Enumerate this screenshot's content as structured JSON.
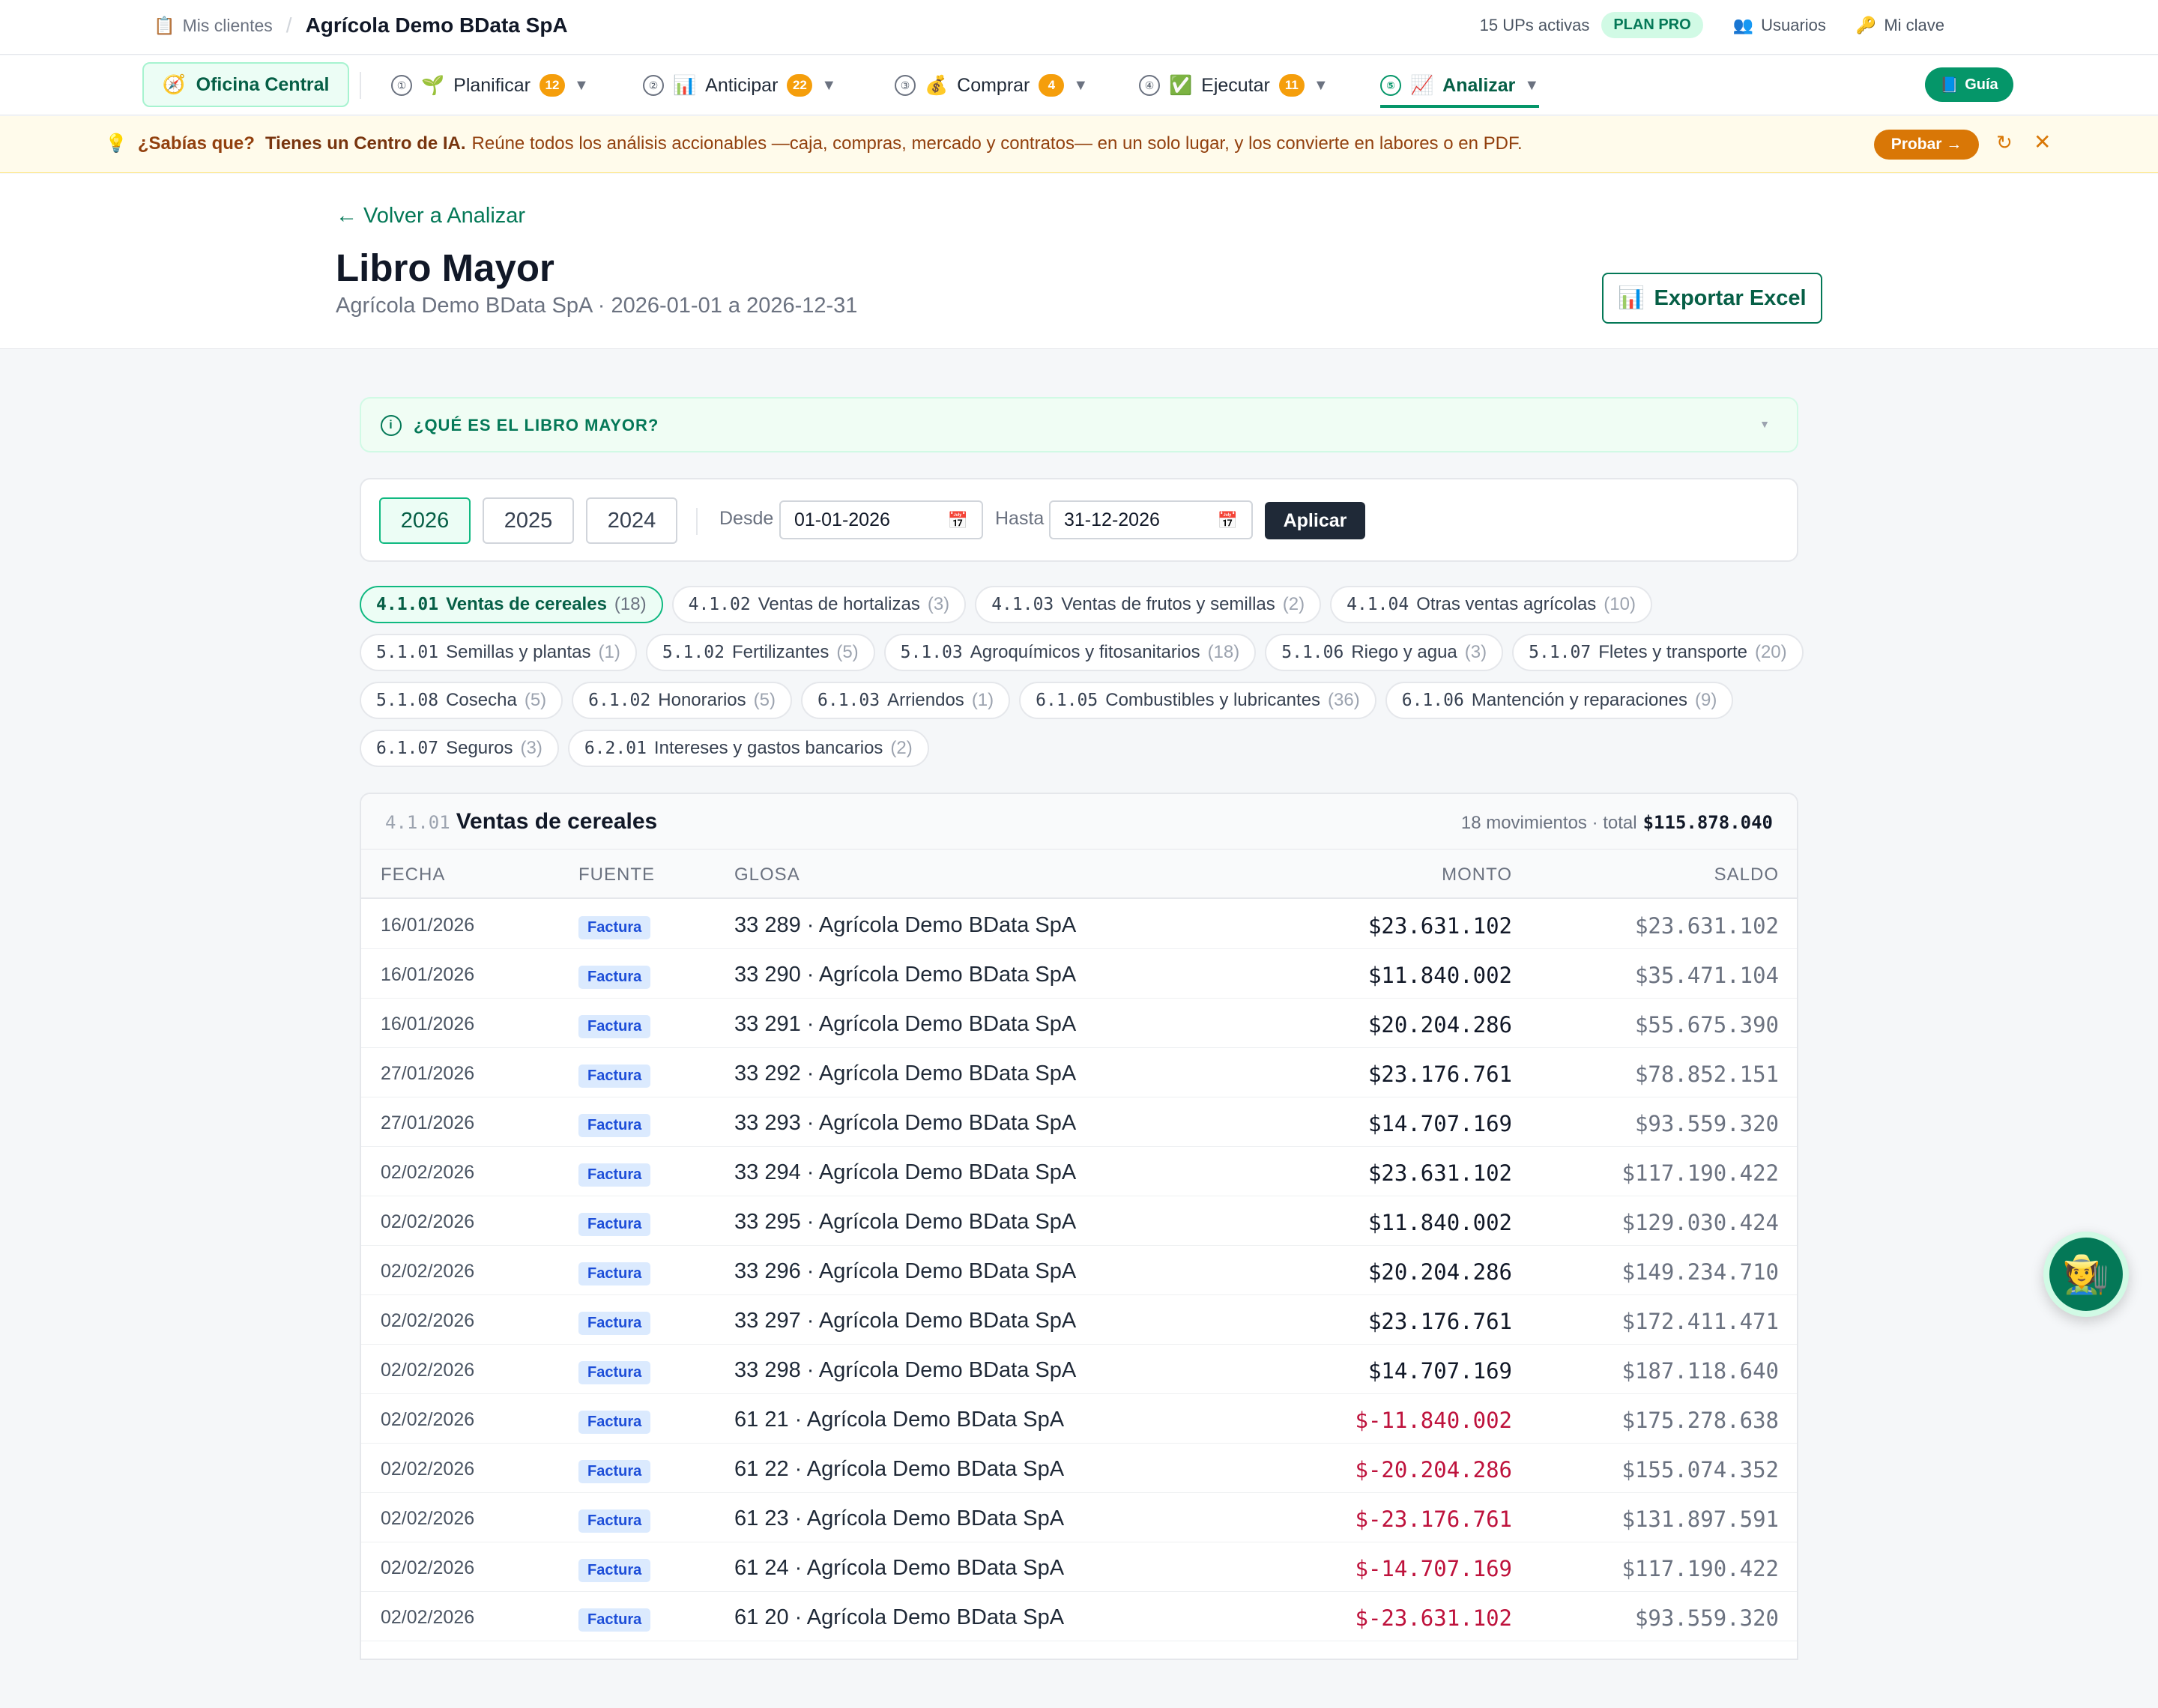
{
  "topbar": {
    "clients_label": "Mis clientes",
    "clients_icon": "clipboard-icon",
    "company": "Agrícola Demo BData SpA",
    "ups": "15 UPs activas",
    "plan": "PLAN PRO",
    "users": "Usuarios",
    "password": "Mi clave"
  },
  "nav": {
    "office": "Oficina Central",
    "items": [
      {
        "num": "①",
        "label": "Planificar",
        "badge": "12"
      },
      {
        "num": "②",
        "label": "Anticipar",
        "badge": "22"
      },
      {
        "num": "③",
        "label": "Comprar",
        "badge": "4"
      },
      {
        "num": "④",
        "label": "Ejecutar",
        "badge": "11"
      },
      {
        "num": "⑤",
        "label": "Analizar",
        "badge": ""
      }
    ],
    "guide": "Guía"
  },
  "tip": {
    "question": "¿Sabías que?",
    "headline": "Tienes un Centro de IA.",
    "body": "Reúne todos los análisis accionables —caja, compras, mercado y contratos— en un solo lugar, y los convierte en labores o en PDF.",
    "try": "Probar →"
  },
  "header": {
    "back": "← Volver a Analizar",
    "title": "Libro Mayor",
    "subtitle": "Agrícola Demo BData SpA · 2026-01-01 a 2026-12-31",
    "export": "Exportar Excel"
  },
  "info": {
    "title": "¿QUÉ ES EL LIBRO MAYOR?"
  },
  "filters": {
    "years": [
      "2026",
      "2025",
      "2024"
    ],
    "active_year": "2026",
    "from_label": "Desde",
    "from_value": "01-01-2026",
    "to_label": "Hasta",
    "to_value": "31-12-2026",
    "apply": "Aplicar"
  },
  "accounts": [
    {
      "code": "4.1.01",
      "name": "Ventas de cereales",
      "count": "(18)",
      "active": true
    },
    {
      "code": "4.1.02",
      "name": "Ventas de hortalizas",
      "count": "(3)"
    },
    {
      "code": "4.1.03",
      "name": "Ventas de frutos y semillas",
      "count": "(2)"
    },
    {
      "code": "4.1.04",
      "name": "Otras ventas agrícolas",
      "count": "(10)"
    },
    {
      "code": "5.1.01",
      "name": "Semillas y plantas",
      "count": "(1)"
    },
    {
      "code": "5.1.02",
      "name": "Fertilizantes",
      "count": "(5)"
    },
    {
      "code": "5.1.03",
      "name": "Agroquímicos y fitosanitarios",
      "count": "(18)"
    },
    {
      "code": "5.1.06",
      "name": "Riego y agua",
      "count": "(3)"
    },
    {
      "code": "5.1.07",
      "name": "Fletes y transporte",
      "count": "(20)"
    },
    {
      "code": "5.1.08",
      "name": "Cosecha",
      "count": "(5)"
    },
    {
      "code": "6.1.02",
      "name": "Honorarios",
      "count": "(5)"
    },
    {
      "code": "6.1.03",
      "name": "Arriendos",
      "count": "(1)"
    },
    {
      "code": "6.1.05",
      "name": "Combustibles y lubricantes",
      "count": "(36)"
    },
    {
      "code": "6.1.06",
      "name": "Mantención y reparaciones",
      "count": "(9)"
    },
    {
      "code": "6.1.07",
      "name": "Seguros",
      "count": "(3)"
    },
    {
      "code": "6.2.01",
      "name": "Intereses y gastos bancarios",
      "count": "(2)"
    }
  ],
  "ledger": {
    "code": "4.1.01",
    "title": "Ventas de cereales",
    "summary": "18 movimientos · total",
    "total": "$115.878.040",
    "columns": {
      "date": "FECHA",
      "source": "FUENTE",
      "gloss": "GLOSA",
      "amount": "MONTO",
      "balance": "SALDO"
    },
    "rows": [
      {
        "date": "16/01/2026",
        "source": "Factura",
        "gloss": "33 289 · Agrícola Demo BData SpA",
        "amount": "$23.631.102",
        "balance": "$23.631.102"
      },
      {
        "date": "16/01/2026",
        "source": "Factura",
        "gloss": "33 290 · Agrícola Demo BData SpA",
        "amount": "$11.840.002",
        "balance": "$35.471.104"
      },
      {
        "date": "16/01/2026",
        "source": "Factura",
        "gloss": "33 291 · Agrícola Demo BData SpA",
        "amount": "$20.204.286",
        "balance": "$55.675.390"
      },
      {
        "date": "27/01/2026",
        "source": "Factura",
        "gloss": "33 292 · Agrícola Demo BData SpA",
        "amount": "$23.176.761",
        "balance": "$78.852.151"
      },
      {
        "date": "27/01/2026",
        "source": "Factura",
        "gloss": "33 293 · Agrícola Demo BData SpA",
        "amount": "$14.707.169",
        "balance": "$93.559.320"
      },
      {
        "date": "02/02/2026",
        "source": "Factura",
        "gloss": "33 294 · Agrícola Demo BData SpA",
        "amount": "$23.631.102",
        "balance": "$117.190.422"
      },
      {
        "date": "02/02/2026",
        "source": "Factura",
        "gloss": "33 295 · Agrícola Demo BData SpA",
        "amount": "$11.840.002",
        "balance": "$129.030.424"
      },
      {
        "date": "02/02/2026",
        "source": "Factura",
        "gloss": "33 296 · Agrícola Demo BData SpA",
        "amount": "$20.204.286",
        "balance": "$149.234.710"
      },
      {
        "date": "02/02/2026",
        "source": "Factura",
        "gloss": "33 297 · Agrícola Demo BData SpA",
        "amount": "$23.176.761",
        "balance": "$172.411.471"
      },
      {
        "date": "02/02/2026",
        "source": "Factura",
        "gloss": "33 298 · Agrícola Demo BData SpA",
        "amount": "$14.707.169",
        "balance": "$187.118.640"
      },
      {
        "date": "02/02/2026",
        "source": "Factura",
        "gloss": "61 21 · Agrícola Demo BData SpA",
        "amount": "$-11.840.002",
        "balance": "$175.278.638",
        "negative": true
      },
      {
        "date": "02/02/2026",
        "source": "Factura",
        "gloss": "61 22 · Agrícola Demo BData SpA",
        "amount": "$-20.204.286",
        "balance": "$155.074.352",
        "negative": true
      },
      {
        "date": "02/02/2026",
        "source": "Factura",
        "gloss": "61 23 · Agrícola Demo BData SpA",
        "amount": "$-23.176.761",
        "balance": "$131.897.591",
        "negative": true
      },
      {
        "date": "02/02/2026",
        "source": "Factura",
        "gloss": "61 24 · Agrícola Demo BData SpA",
        "amount": "$-14.707.169",
        "balance": "$117.190.422",
        "negative": true
      },
      {
        "date": "02/02/2026",
        "source": "Factura",
        "gloss": "61 20 · Agrícola Demo BData SpA",
        "amount": "$-23.631.102",
        "balance": "$93.559.320",
        "negative": true
      }
    ]
  },
  "colors": {
    "accent": "#059669",
    "negative": "#be123c",
    "warning": "#d97706"
  }
}
